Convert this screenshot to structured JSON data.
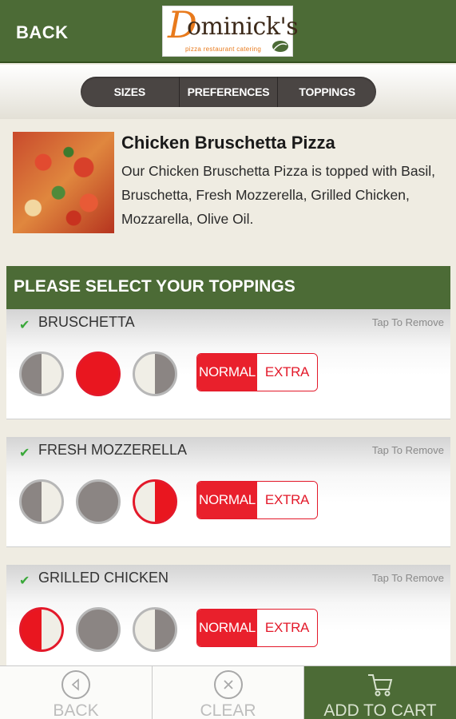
{
  "header": {
    "back_label": "BACK",
    "logo_initial": "D",
    "logo_name": "ominick's",
    "logo_tagline": "pizza restaurant catering"
  },
  "tabs": [
    {
      "label": "SIZES"
    },
    {
      "label": "PREFERENCES"
    },
    {
      "label": "TOPPINGS"
    }
  ],
  "product": {
    "title": "Chicken Bruschetta Pizza",
    "description": "Our Chicken Bruschetta Pizza is topped with Basil, Bruschetta, Fresh Mozzerella, Grilled Chicken, Mozzarella, Olive Oil."
  },
  "toppings_section": {
    "title": "PLEASE SELECT YOUR TOPPINGS"
  },
  "toppings": [
    {
      "name": "BRUSCHETTA",
      "remove_label": "Tap To Remove",
      "selected_portion": "whole",
      "amount": "normal",
      "normal_label": "NORMAL",
      "extra_label": "EXTRA"
    },
    {
      "name": "FRESH MOZZERELLA",
      "remove_label": "Tap To Remove",
      "selected_portion": "right-half",
      "amount": "normal",
      "normal_label": "NORMAL",
      "extra_label": "EXTRA"
    },
    {
      "name": "GRILLED CHICKEN",
      "remove_label": "Tap To Remove",
      "selected_portion": "left-half",
      "amount": "normal",
      "normal_label": "NORMAL",
      "extra_label": "EXTRA"
    }
  ],
  "bottom_bar": {
    "back_label": "BACK",
    "clear_label": "CLEAR",
    "cart_label": "ADD TO CART"
  },
  "colors": {
    "brand_green": "#4c6b36",
    "accent_red": "#e9202c",
    "tab_dark": "#4a4543"
  },
  "icons": {
    "back": "circle-arrow-left-icon",
    "clear": "circle-x-icon",
    "cart": "shopping-cart-icon",
    "check": "checkmark-icon"
  }
}
